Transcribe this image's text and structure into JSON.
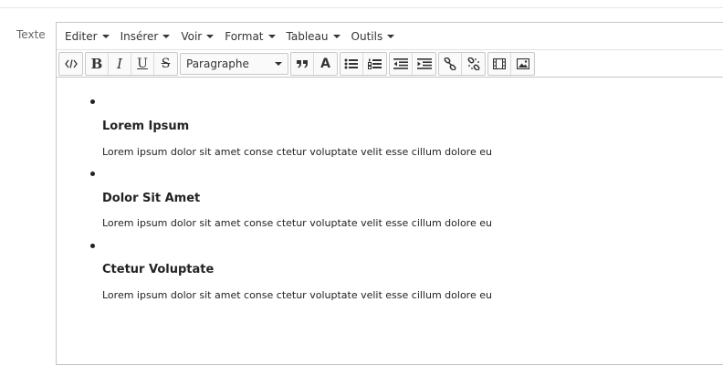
{
  "field": {
    "label": "Texte"
  },
  "menu": [
    {
      "label": "Editer"
    },
    {
      "label": "Insérer"
    },
    {
      "label": "Voir"
    },
    {
      "label": "Format"
    },
    {
      "label": "Tableau"
    },
    {
      "label": "Outils"
    }
  ],
  "toolbar": {
    "format_select": "Paragraphe",
    "icons": [
      "code-icon",
      "bold-icon",
      "italic-icon",
      "underline-icon",
      "strikethrough-icon",
      "blockquote-icon",
      "text-color-icon",
      "bullet-list-icon",
      "numbered-list-icon",
      "outdent-icon",
      "indent-icon",
      "link-icon",
      "unlink-icon",
      "media-icon",
      "image-icon"
    ],
    "bold_glyph": "B",
    "italic_glyph": "I",
    "underline_glyph": "U",
    "strike_glyph": "S",
    "color_glyph": "A"
  },
  "content": {
    "items": [
      {
        "title": "Lorem Ipsum",
        "text": "Lorem ipsum dolor sit amet conse ctetur voluptate velit esse cillum dolore eu"
      },
      {
        "title": "Dolor Sit Amet",
        "text": "Lorem ipsum dolor sit amet conse ctetur voluptate velit esse cillum dolore eu"
      },
      {
        "title": "Ctetur Voluptate",
        "text": "Lorem ipsum dolor sit amet conse ctetur voluptate velit esse cillum dolore eu"
      }
    ]
  }
}
